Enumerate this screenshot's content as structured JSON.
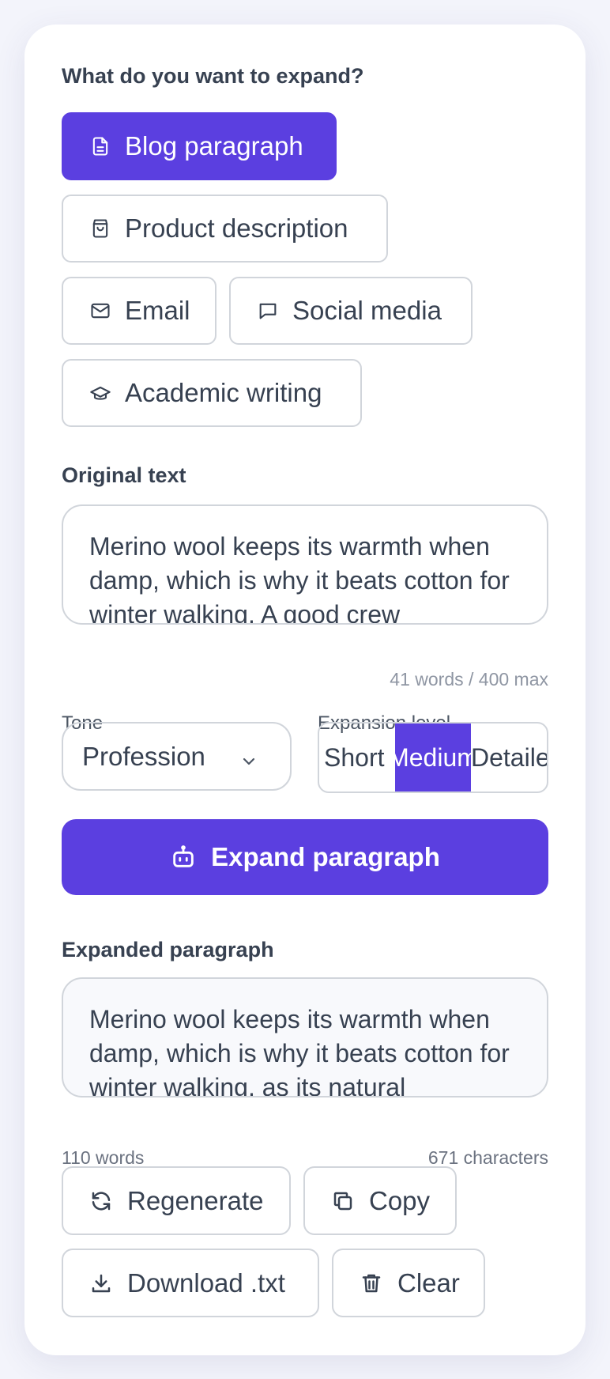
{
  "content_type": {
    "label": "What do you want to expand?",
    "options": [
      {
        "label": "Blog paragraph",
        "icon": "document-icon",
        "selected": true
      },
      {
        "label": "Product description",
        "icon": "shopping-bag-icon",
        "selected": false
      },
      {
        "label": "Email",
        "icon": "mail-icon",
        "selected": false
      },
      {
        "label": "Social media",
        "icon": "chat-bubble-icon",
        "selected": false
      },
      {
        "label": "Academic writing",
        "icon": "graduation-cap-icon",
        "selected": false
      }
    ]
  },
  "original": {
    "label": "Original text",
    "text": "Merino wool keeps its warmth when damp, which is why it beats cotton for winter walking. A good crew",
    "count": "41 words / 400 max"
  },
  "tone": {
    "label": "Tone",
    "value": "Profession"
  },
  "expansion": {
    "label": "Expansion level",
    "options": [
      "Short",
      "Medium",
      "Detailed"
    ],
    "selected": "Medium"
  },
  "expand_button": {
    "label": "Expand paragraph",
    "icon": "robot-icon"
  },
  "expanded": {
    "label": "Expanded paragraph",
    "text": "Merino wool keeps its warmth when damp, which is why it beats cotton for winter walking, as its natural",
    "words": "110 words",
    "characters": "671 characters"
  },
  "actions": {
    "regenerate": "Regenerate",
    "copy": "Copy",
    "download": "Download .txt",
    "clear": "Clear"
  },
  "colors": {
    "accent": "#5b3fe0",
    "border": "#d1d5db",
    "text": "#374151",
    "muted": "#8f96a3",
    "background": "#f3f4fb"
  }
}
